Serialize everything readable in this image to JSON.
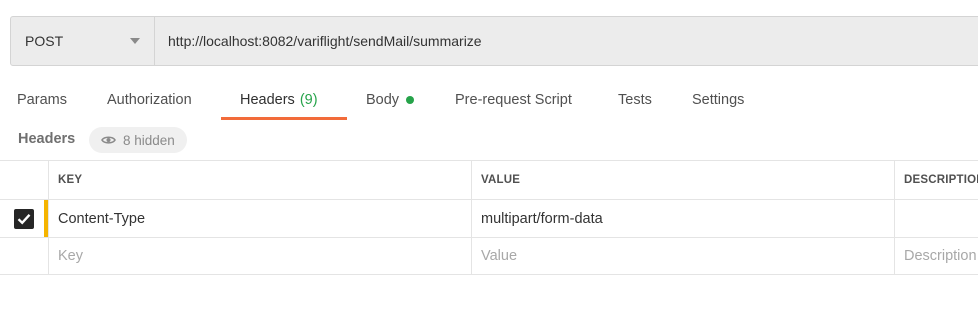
{
  "request": {
    "method": "POST",
    "url": "http://localhost:8082/variflight/sendMail/summarize"
  },
  "tabs": [
    {
      "label": "Params"
    },
    {
      "label": "Authorization"
    },
    {
      "label": "Headers",
      "count": "(9)",
      "active": true
    },
    {
      "label": "Body",
      "indicator": "green-dot"
    },
    {
      "label": "Pre-request Script"
    },
    {
      "label": "Tests"
    },
    {
      "label": "Settings"
    }
  ],
  "headers_section": {
    "title": "Headers",
    "hidden_label": "8 hidden",
    "hidden_icon": "eye-icon"
  },
  "table": {
    "columns": [
      "KEY",
      "VALUE",
      "DESCRIPTION"
    ],
    "rows": [
      {
        "checked": true,
        "key": "Content-Type",
        "value": "multipart/form-data",
        "description": ""
      }
    ],
    "placeholders": {
      "key": "Key",
      "value": "Value",
      "description": "Description"
    }
  },
  "colors": {
    "active_tab_underline": "#f26b3a",
    "count_green": "#26a34a",
    "row_marker": "#f5b400"
  }
}
